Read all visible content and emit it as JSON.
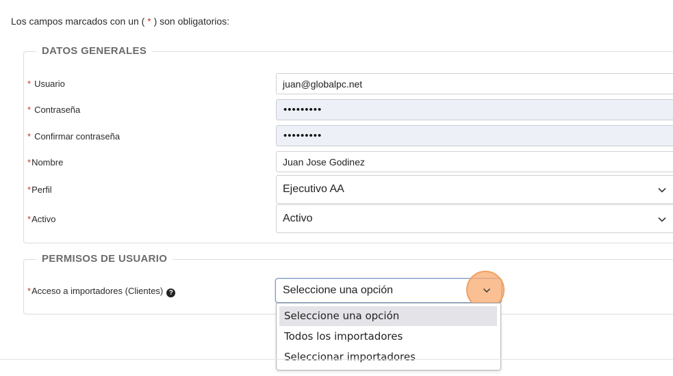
{
  "intro": {
    "prefix": "Los campos marcados con un (",
    "star": "*",
    "suffix": ") son obligatorios:"
  },
  "general": {
    "legend": "DATOS GENERALES",
    "usuario": {
      "label": "Usuario",
      "value": "juan@globalpc.net"
    },
    "contrasena": {
      "label": "Contraseña",
      "value": "•••••••••"
    },
    "confirmar": {
      "label": "Confirmar contraseña",
      "value": "•••••••••"
    },
    "nombre": {
      "label": "Nombre",
      "value": "Juan Jose Godinez"
    },
    "perfil": {
      "label": "Perfil",
      "value": "Ejecutivo AA"
    },
    "activo": {
      "label": "Activo",
      "value": "Activo"
    }
  },
  "permisos": {
    "legend": "PERMISOS DE USUARIO",
    "acceso": {
      "label": "Acceso a importadores (Clientes)",
      "help_icon": "question-circle-icon",
      "value": "Seleccione una opción"
    },
    "options": [
      "Seleccione una opción",
      "Todos los importadores",
      "Seleccionar importadores"
    ]
  },
  "colors": {
    "required_star": "#c0392b",
    "highlight": "#e3e3e8",
    "cursor": "#f8aa6e"
  }
}
